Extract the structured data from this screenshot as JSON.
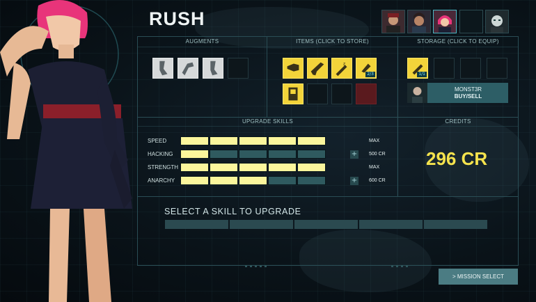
{
  "character": {
    "name": "RUSH",
    "roster": [
      "agent-1",
      "agent-2",
      "agent-3",
      "agent-4",
      "agent-5"
    ]
  },
  "panels": {
    "augments": "AUGMENTS",
    "items": "ITEMS (CLICK TO STORE)",
    "storage": "STORAGE (CLICK TO EQUIP)",
    "upgrade_skills": "UPGRADE SKILLS",
    "credits": "CREDITS"
  },
  "augments": {
    "slots": [
      "leg-augment-icon",
      "arm-augment-icon",
      "leg-augment-icon",
      "empty"
    ]
  },
  "items": {
    "slots": [
      "flashlight-icon",
      "gun-icon",
      "syringe-icon",
      "stimpack-icon",
      "id-card-icon",
      "empty",
      "empty",
      "locked"
    ],
    "badge": "2/3"
  },
  "storage": {
    "slots": [
      "syringe-icon",
      "empty",
      "empty",
      "empty"
    ],
    "badge": "1/1",
    "vendor_name": "MONST3R",
    "vendor_action": "BUY/SELL"
  },
  "skills": [
    {
      "name": "SPEED",
      "level": 5,
      "max": 5,
      "status": "MAX",
      "can_upgrade": false
    },
    {
      "name": "HACKING",
      "level": 1,
      "max": 5,
      "status": "500 CR",
      "can_upgrade": true
    },
    {
      "name": "STRENGTH",
      "level": 5,
      "max": 5,
      "status": "MAX",
      "can_upgrade": false
    },
    {
      "name": "ANARCHY",
      "level": 3,
      "max": 5,
      "status": "600 CR",
      "can_upgrade": true
    }
  ],
  "credits": "296 CR",
  "upgrade_prompt": "SELECT A SKILL TO UPGRADE",
  "mission_select": "> MISSION SELECT",
  "colors": {
    "bar_on": "#fbf69c",
    "bar_off": "#2f5a5f",
    "credits": "#f5e34d",
    "accent": "#4bb8c4"
  }
}
